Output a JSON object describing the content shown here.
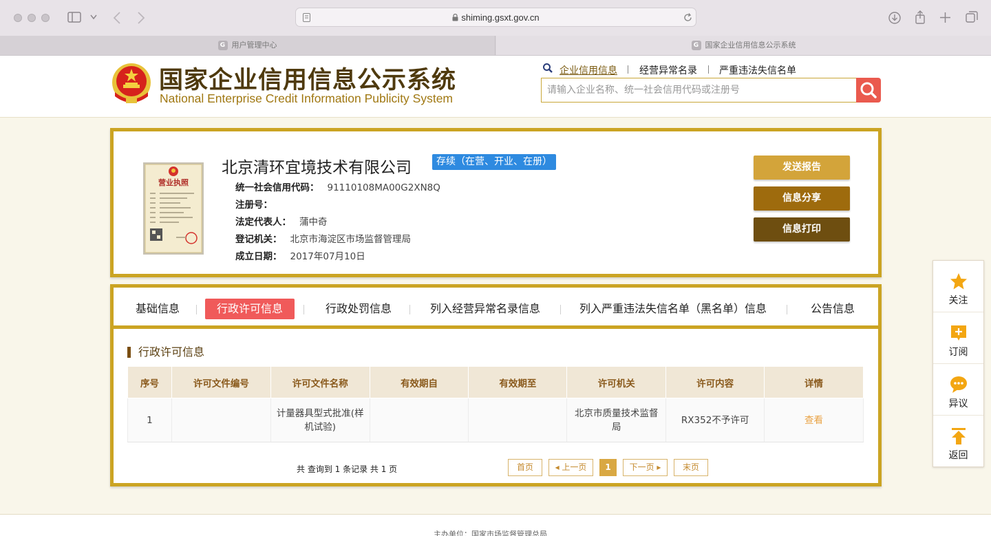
{
  "browser": {
    "url": "shiming.gsxt.gov.cn",
    "tabs": [
      {
        "label": "用户管理中心",
        "favicon": "G"
      },
      {
        "label": "国家企业信用信息公示系统",
        "favicon": "G"
      }
    ]
  },
  "header": {
    "title": "国家企业信用信息公示系统",
    "subtitle": "National Enterprise Credit Information Publicity System",
    "nav": [
      "企业信用信息",
      "经营异常名录",
      "严重违法失信名单"
    ],
    "search_placeholder": "请输入企业名称、统一社会信用代码或注册号"
  },
  "company": {
    "name": "北京清环宜境技术有限公司",
    "status": "存续（在营、开业、在册）",
    "fields": [
      {
        "label": "统一社会信用代码：",
        "value": "91110108MA00G2XN8Q"
      },
      {
        "label": "注册号：",
        "value": ""
      },
      {
        "label": "法定代表人：",
        "value": "蒲中奇"
      },
      {
        "label": "登记机关：",
        "value": "北京市海淀区市场监督管理局"
      },
      {
        "label": "成立日期：",
        "value": "2017年07月10日"
      }
    ],
    "license_title": "营业执照",
    "actions": [
      "发送报告",
      "信息分享",
      "信息打印"
    ]
  },
  "sections": {
    "tabs": [
      "基础信息",
      "行政许可信息",
      "行政处罚信息",
      "列入经营异常名录信息",
      "列入严重违法失信名单（黑名单）信息",
      "公告信息"
    ],
    "active_tab": "行政许可信息",
    "current_title": "行政许可信息"
  },
  "permits_table": {
    "headers": [
      "序号",
      "许可文件编号",
      "许可文件名称",
      "有效期自",
      "有效期至",
      "许可机关",
      "许可内容",
      "详情"
    ],
    "rows": [
      {
        "index": "1",
        "doc_no": "",
        "doc_name": "计量器具型式批准(样机试验)",
        "valid_from": "",
        "valid_to": "",
        "authority": "北京市质量技术监督局",
        "content": "RX352不予许可",
        "detail": "查看"
      }
    ]
  },
  "pagination": {
    "summary": "共 查询到 1 条记录 共 1 页",
    "first": "首页",
    "prev": "◂ 上一页",
    "current": "1",
    "next": "下一页 ▸",
    "last": "末页"
  },
  "float_bar": [
    "关注",
    "订阅",
    "异议",
    "返回"
  ],
  "footer": {
    "text": "主办单位：国家市场监督管理总局"
  },
  "colors": {
    "gold": "#cba423",
    "red": "#f05a5a",
    "blue": "#2e8ae0",
    "brown": "#6e4e10"
  }
}
